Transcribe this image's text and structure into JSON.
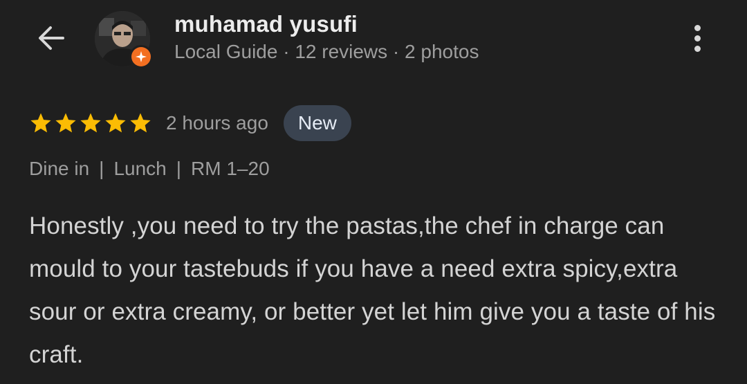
{
  "header": {
    "back_icon": "arrow-left-icon",
    "avatar_badge_icon": "local-guide-star-icon",
    "avatar_badge_color": "#f36f21",
    "user_name": "muhamad yusufi",
    "user_meta": "Local Guide · 12 reviews · 2 photos",
    "more_icon": "more-vertical-icon"
  },
  "review": {
    "rating": 5,
    "rating_max": 5,
    "star_color": "#fbbc04",
    "time_ago": "2 hours ago",
    "new_badge": "New",
    "tags": [
      "Dine in",
      "Lunch",
      "RM 1–20"
    ],
    "tag_separator": "|",
    "text": "Honestly ,you need to try the pastas,the chef in charge can mould to your tastebuds if you have a need extra spicy,extra sour or extra creamy, or better yet let him give you a taste of his craft."
  }
}
